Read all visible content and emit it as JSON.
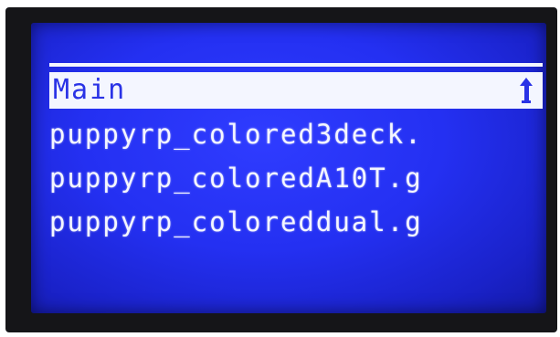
{
  "screen": {
    "header": {
      "title": "Main",
      "icon": "up-arrow-icon"
    },
    "files": [
      {
        "name": "puppyrp_colored3deck."
      },
      {
        "name": "puppyrp_coloredA10T.g"
      },
      {
        "name": "puppyrp_coloreddual.g"
      }
    ]
  },
  "colors": {
    "lcd_background": "#2430f2",
    "foreground": "#f4f6ff",
    "bezel": "#151518"
  }
}
